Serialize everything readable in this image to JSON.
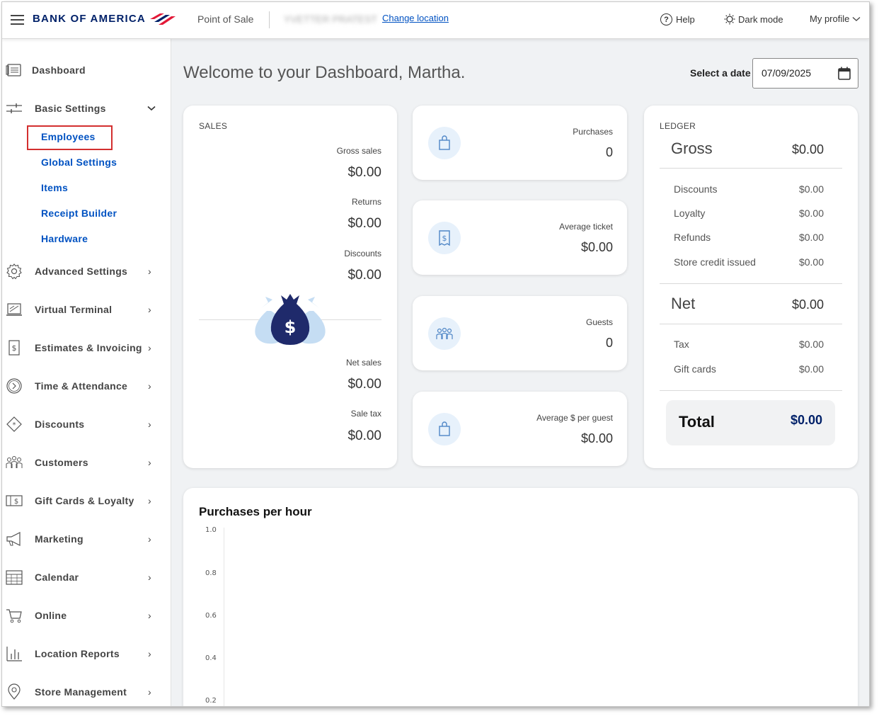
{
  "header": {
    "logo_text": "BANK OF AMERICA",
    "app_title": "Point of Sale",
    "location_name": "YVETTER PRATEST",
    "change_location": "Change location",
    "help": "Help",
    "dark_mode": "Dark mode",
    "profile": "My profile",
    "brand_color": "#012169",
    "accent_color": "#e31837"
  },
  "sidebar": {
    "items": [
      {
        "label": "Dashboard",
        "icon": "dashboard-icon"
      },
      {
        "label": "Basic Settings",
        "icon": "sliders-icon",
        "expanded": true
      },
      {
        "label": "Advanced Settings",
        "icon": "gear-icon"
      },
      {
        "label": "Virtual Terminal",
        "icon": "terminal-icon"
      },
      {
        "label": "Estimates & Invoicing",
        "icon": "invoice-icon"
      },
      {
        "label": "Time & Attendance",
        "icon": "clock-icon"
      },
      {
        "label": "Discounts",
        "icon": "tag-icon"
      },
      {
        "label": "Customers",
        "icon": "people-icon"
      },
      {
        "label": "Gift Cards & Loyalty",
        "icon": "gift-card-icon"
      },
      {
        "label": "Marketing",
        "icon": "megaphone-icon"
      },
      {
        "label": "Calendar",
        "icon": "calendar-icon"
      },
      {
        "label": "Online",
        "icon": "cart-icon"
      },
      {
        "label": "Location Reports",
        "icon": "bar-chart-icon"
      },
      {
        "label": "Store Management",
        "icon": "location-pin-icon"
      }
    ],
    "sub_items": [
      "Employees",
      "Global Settings",
      "Items",
      "Receipt Builder",
      "Hardware"
    ]
  },
  "main": {
    "welcome": "Welcome to your Dashboard, Martha.",
    "date_label": "Select a date",
    "date_value": "07/09/2025"
  },
  "sales": {
    "heading": "SALES",
    "gross_label": "Gross sales",
    "gross_value": "$0.00",
    "returns_label": "Returns",
    "returns_value": "$0.00",
    "discounts_label": "Discounts",
    "discounts_value": "$0.00",
    "net_label": "Net sales",
    "net_value": "$0.00",
    "tax_label": "Sale tax",
    "tax_value": "$0.00"
  },
  "stats": [
    {
      "label": "Purchases",
      "value": "0",
      "icon": "shopping-bag-icon"
    },
    {
      "label": "Average ticket",
      "value": "$0.00",
      "icon": "receipt-icon"
    },
    {
      "label": "Guests",
      "value": "0",
      "icon": "guests-icon"
    },
    {
      "label": "Average $ per guest",
      "value": "$0.00",
      "icon": "shopping-bag-icon"
    }
  ],
  "ledger": {
    "heading": "LEDGER",
    "gross_label": "Gross",
    "gross_value": "$0.00",
    "rows1": [
      {
        "label": "Discounts",
        "value": "$0.00"
      },
      {
        "label": "Loyalty",
        "value": "$0.00"
      },
      {
        "label": "Refunds",
        "value": "$0.00"
      },
      {
        "label": "Store credit issued",
        "value": "$0.00"
      }
    ],
    "net_label": "Net",
    "net_value": "$0.00",
    "rows2": [
      {
        "label": "Tax",
        "value": "$0.00"
      },
      {
        "label": "Gift cards",
        "value": "$0.00"
      }
    ],
    "total_label": "Total",
    "total_value": "$0.00"
  },
  "chart_data": {
    "type": "bar",
    "title": "Purchases per hour",
    "y_ticks": [
      "1.0",
      "0.8",
      "0.6",
      "0.4",
      "0.2"
    ],
    "ylim": [
      0,
      1.0
    ],
    "categories": [],
    "values": []
  }
}
